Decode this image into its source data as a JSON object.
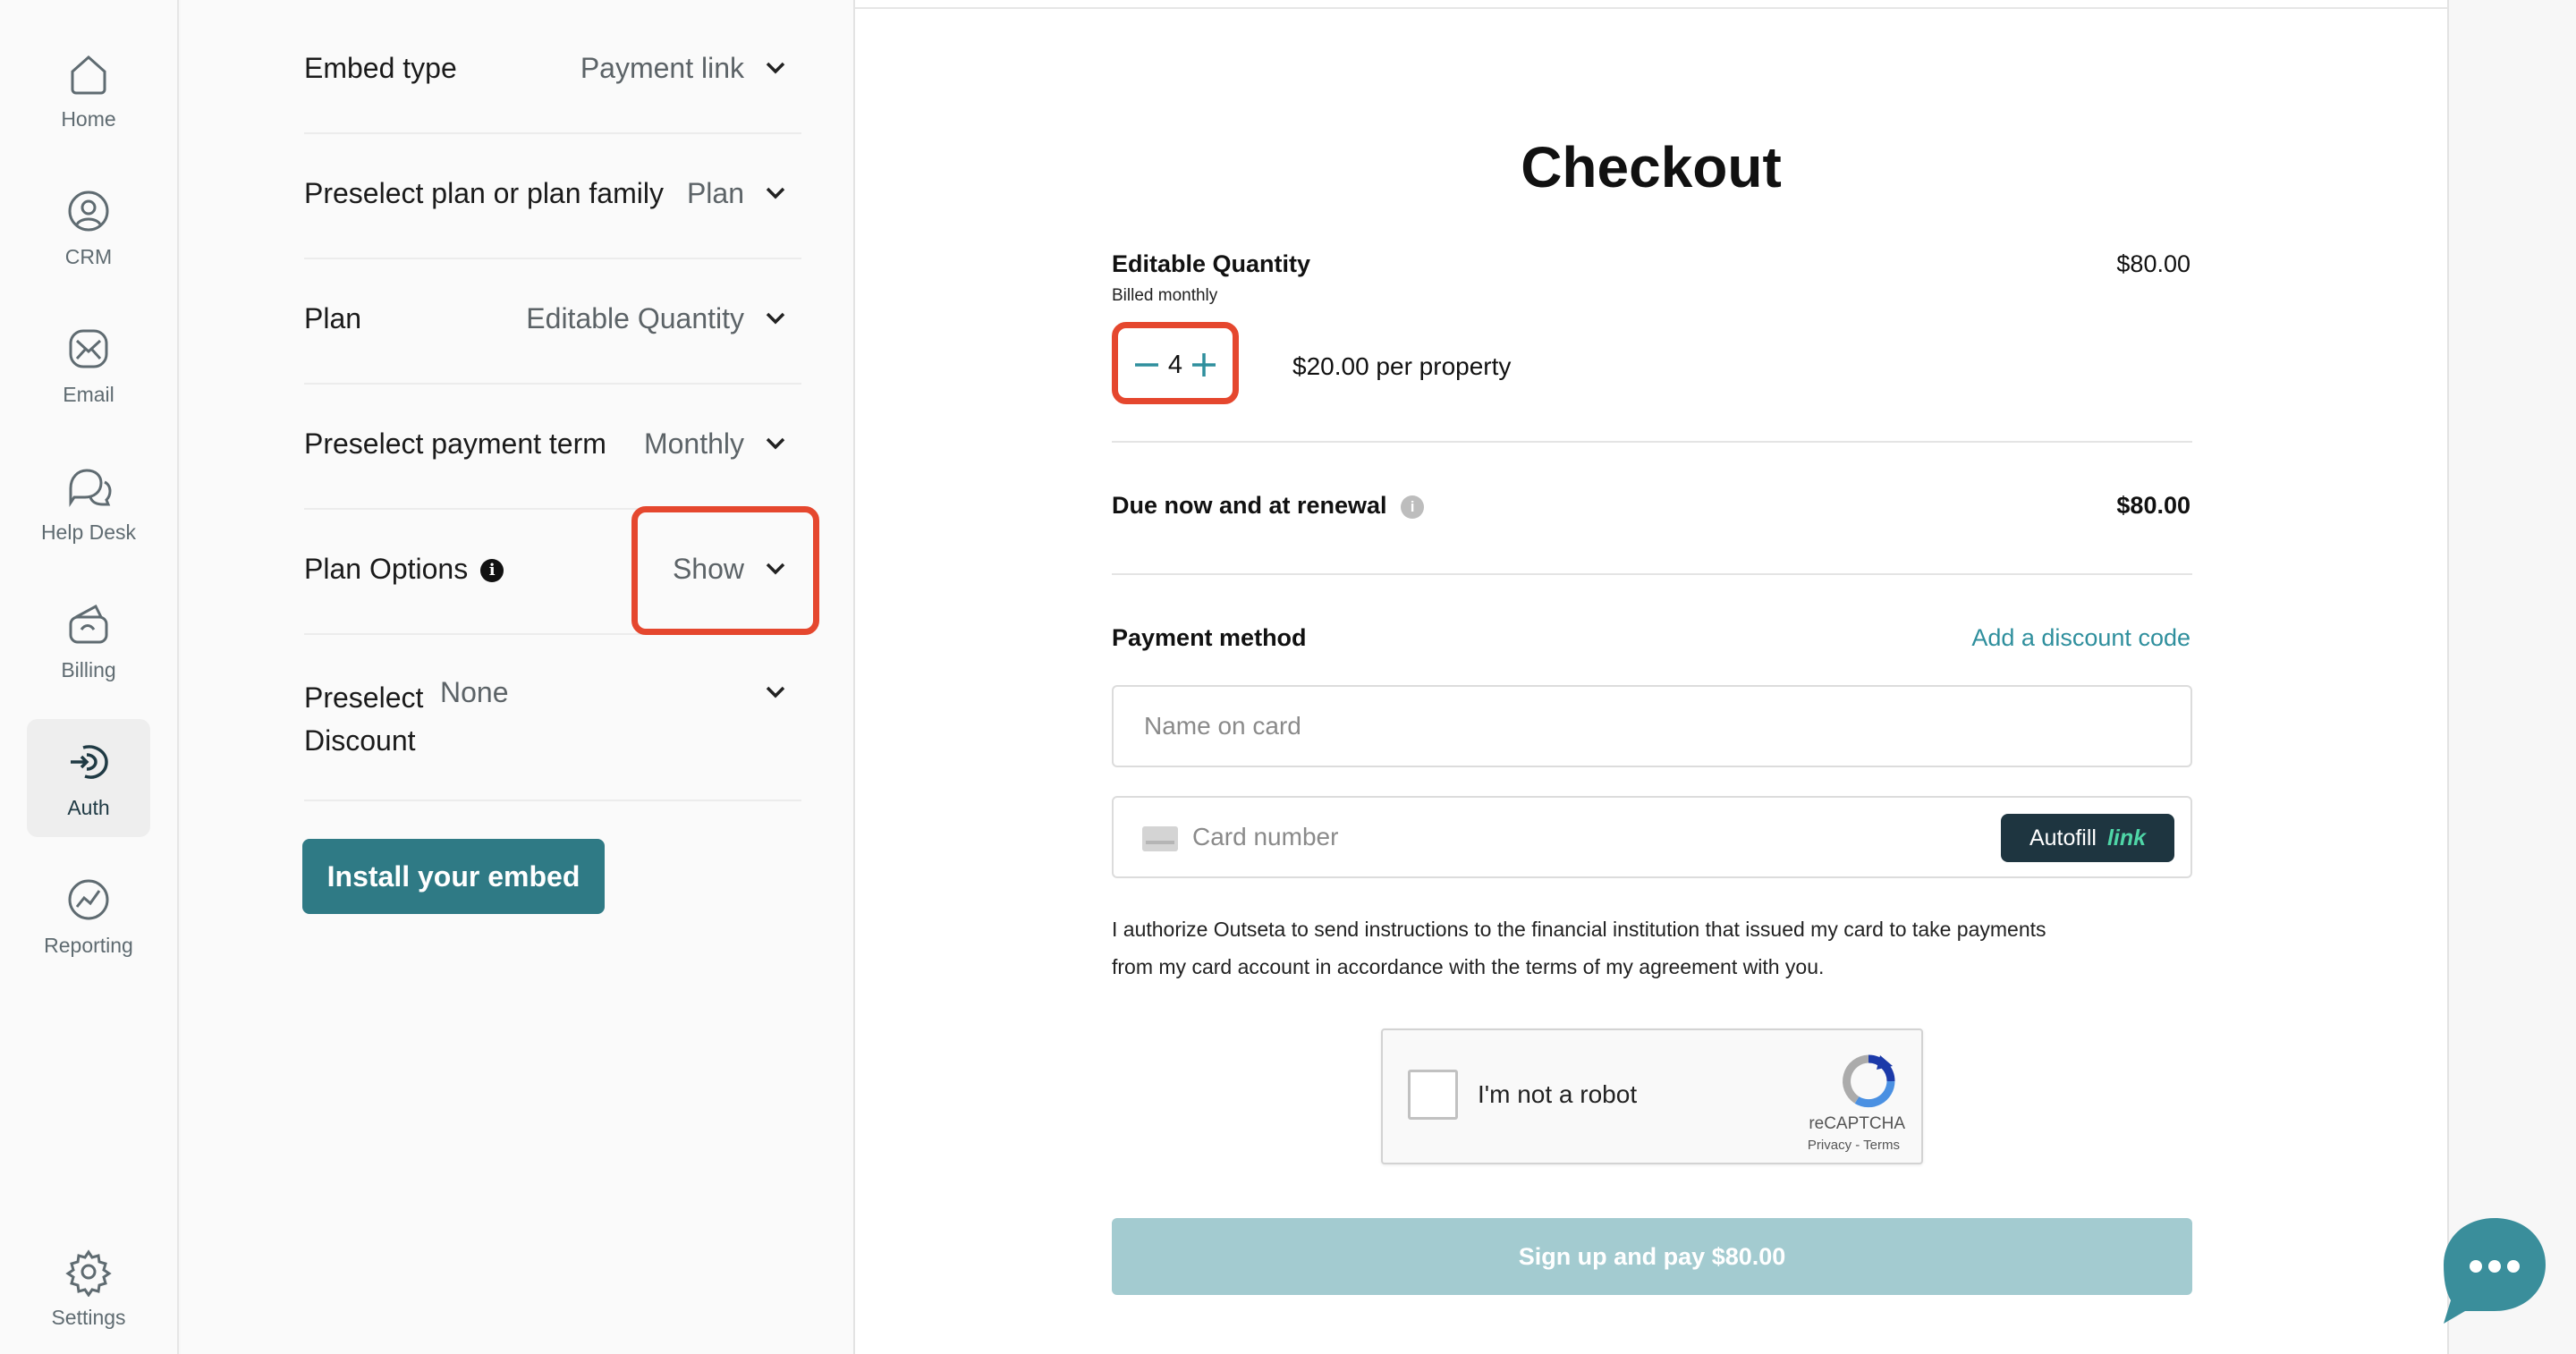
{
  "nav": {
    "items": [
      {
        "label": "Home",
        "icon": "home-icon"
      },
      {
        "label": "CRM",
        "icon": "user-circle-icon"
      },
      {
        "label": "Email",
        "icon": "email-icon"
      },
      {
        "label": "Help Desk",
        "icon": "chat-bubbles-icon"
      },
      {
        "label": "Billing",
        "icon": "wallet-icon"
      },
      {
        "label": "Auth",
        "icon": "auth-icon",
        "active": true
      },
      {
        "label": "Reporting",
        "icon": "chart-circle-icon"
      }
    ],
    "settings": {
      "label": "Settings",
      "icon": "gear-icon"
    }
  },
  "config": {
    "embed_type": {
      "label": "Embed type",
      "value": "Payment link"
    },
    "preselect_plan": {
      "label": "Preselect plan or plan family",
      "value": "Plan"
    },
    "plan": {
      "label": "Plan",
      "value": "Editable Quantity"
    },
    "payment_term": {
      "label": "Preselect payment term",
      "value": "Monthly"
    },
    "plan_options": {
      "label": "Plan Options",
      "value": "Show",
      "info": "i"
    },
    "discount": {
      "label_line1": "Preselect",
      "label_line2": "Discount",
      "value": "None"
    },
    "install_button": "Install your embed"
  },
  "checkout": {
    "title": "Checkout",
    "plan_name": "Editable Quantity",
    "billing": "Billed monthly",
    "plan_price": "$80.00",
    "quantity": "4",
    "unit_price": "$20.00 per property",
    "due_label": "Due now and at renewal",
    "due_amount": "$80.00",
    "payment_method_label": "Payment method",
    "discount_link": "Add a discount code",
    "name_placeholder": "Name on card",
    "card_placeholder": "Card number",
    "autofill_label": "Autofill",
    "autofill_link": "link",
    "authorization": "I authorize Outseta to send instructions to the financial institution that issued my card to take payments from my card account in accordance with the terms of my agreement with you.",
    "captcha": {
      "label": "I'm not a robot",
      "brand": "reCAPTCHA",
      "links": "Privacy - Terms"
    },
    "pay_button": "Sign up and pay $80.00"
  },
  "colors": {
    "accent": "#2f7a85",
    "highlight": "#e5472e",
    "link": "#2f8f9d",
    "pay_disabled": "#a3cbd0",
    "chat": "#3a8e9b"
  }
}
